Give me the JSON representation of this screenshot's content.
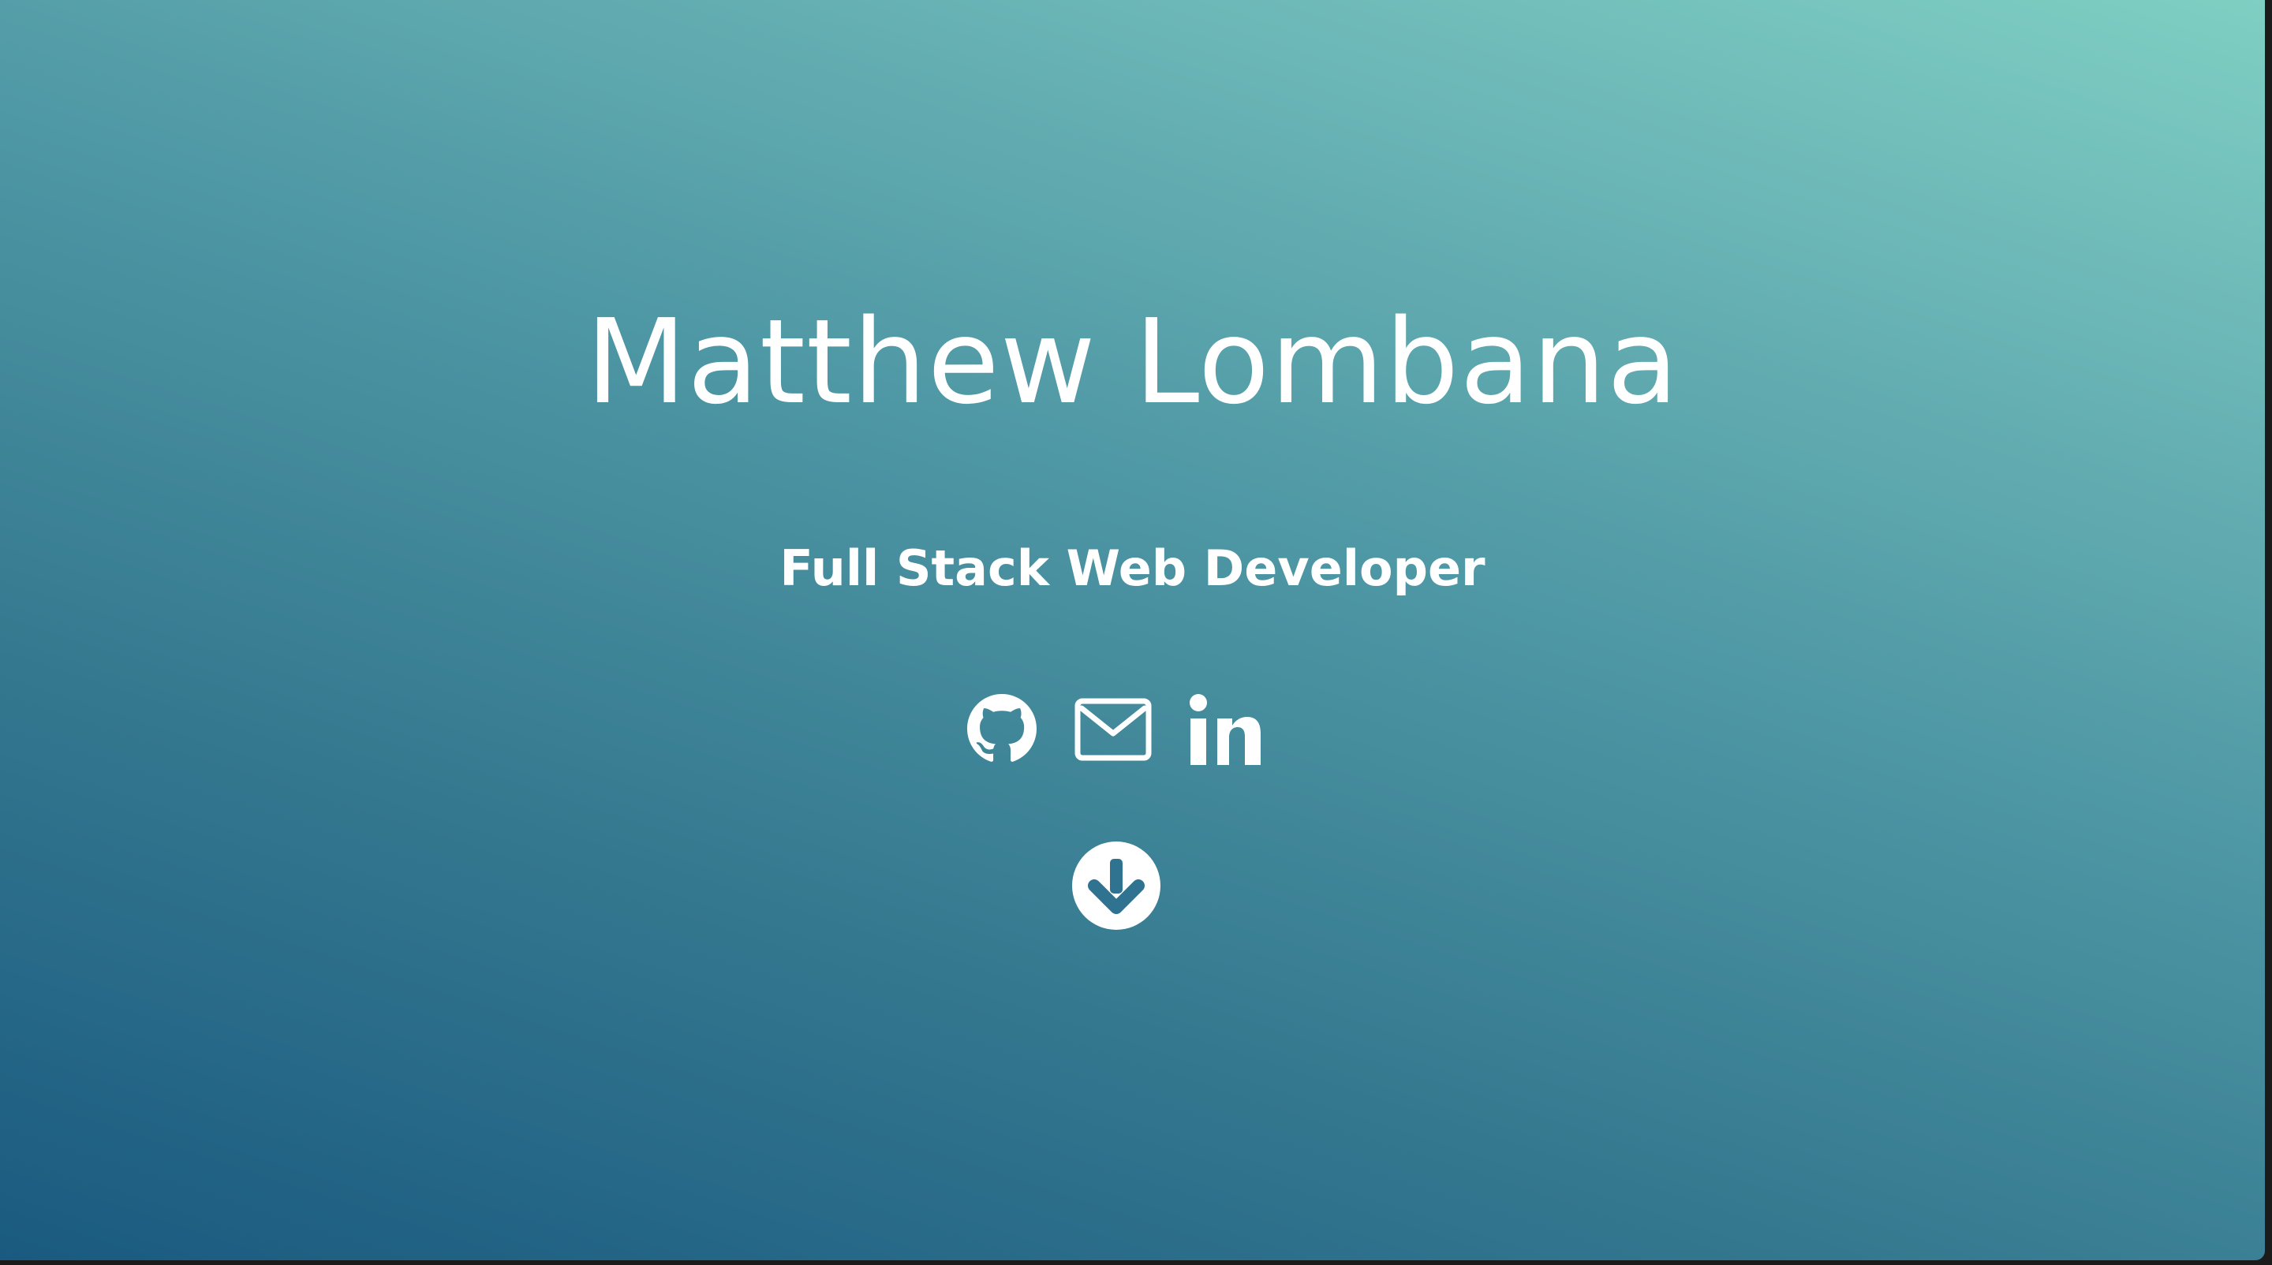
{
  "hero": {
    "name": "Matthew Lombana",
    "subtitle": "Full Stack Web Developer"
  },
  "social_links": [
    {
      "icon": "github-icon",
      "label": "GitHub"
    },
    {
      "icon": "mail-icon",
      "label": "Email"
    },
    {
      "icon": "linkedin-icon",
      "label": "LinkedIn"
    }
  ],
  "scroll_button": {
    "icon": "arrow-down-circle-icon",
    "label": "Scroll down"
  },
  "colors": {
    "gradient_start": "#1a5a80",
    "gradient_end": "#7fcfc3",
    "text": "#ffffff"
  }
}
